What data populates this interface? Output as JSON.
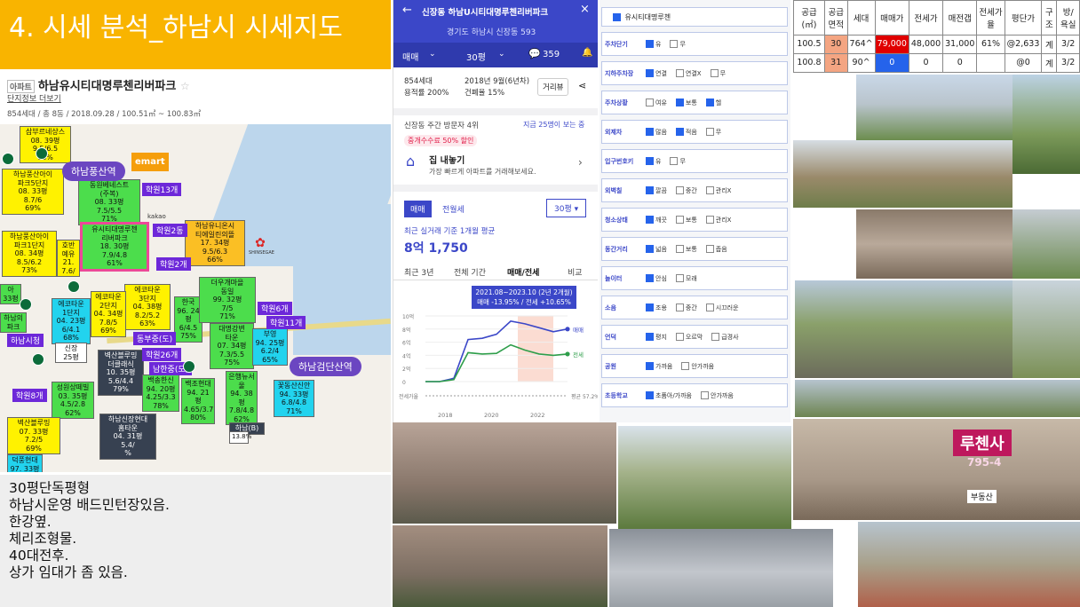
{
  "title": "4. 시세 분석_하남시 시세지도",
  "left": {
    "tag": "아파트",
    "complex_name": "하남유시티대명루첸리버파크",
    "info_link": "단지정보 더보기",
    "summary": "854세대 / 총 8동 / 2018.09.28 / 100.51㎡ ~ 100.83㎡"
  },
  "map": {
    "markers": [
      {
        "text": "삼부르네상스\n08. 39평\n9.5/6.5\n68%",
        "cls": "y"
      },
      {
        "text": "하남풍산아이\n파크5단지\n08. 33평\n8.7/6\n69%",
        "cls": "y"
      },
      {
        "text": "동원베네스트\n(주복)\n08. 33평\n7.5/5.5\n71%",
        "cls": "g"
      },
      {
        "text": "유시티대명루첸\n리버파크\n18. 30평\n7.9/4.8\n61%",
        "cls": "g"
      },
      {
        "text": "하남풍산아이\n파크1단지\n08. 34평\n8.5/6.2\n73%",
        "cls": "y"
      },
      {
        "text": "호반\n예유\n21.\n7.6/",
        "cls": "y"
      },
      {
        "text": "하남유니온시\n티에일린의뜰\n17. 34평\n9.5/6.3\n66%",
        "cls": "o"
      },
      {
        "text": "에코타운\n3단지\n04. 38평\n8.2/5.2\n63%",
        "cls": "y"
      },
      {
        "text": "에코타운\n2단지\n04. 34평\n7.8/5\n69%",
        "cls": "y"
      },
      {
        "text": "에코타운\n1단지\n04. 23평\n6/4.1\n68%",
        "cls": "c"
      },
      {
        "text": "한국\n96. 24평\n6/4.5\n75%",
        "cls": "g"
      },
      {
        "text": "더우개마을\n동일\n99. 32평\n7/5\n71%",
        "cls": "g"
      },
      {
        "text": "대명강변\n타운\n07. 34평\n7.3/5.5\n75%",
        "cls": "g"
      },
      {
        "text": "부영\n94. 25평\n6.2/4\n65%",
        "cls": "c"
      },
      {
        "text": "신장\n25평",
        "cls": "w"
      },
      {
        "text": "벽산블루밍\n더클래식\n10. 35평\n5.6/4.4\n79%",
        "cls": "b"
      },
      {
        "text": "백송한신\n94. 20평\n4.25/3.3\n78%",
        "cls": "g"
      },
      {
        "text": "백조현대\n94. 21평\n4.65/3.7\n80%",
        "cls": "g"
      },
      {
        "text": "은행뉴서\n울\n94. 38평\n7.8/4.8\n62%",
        "cls": "g"
      },
      {
        "text": "꽃동산신안\n94. 33평\n6.8/4.8\n71%",
        "cls": "c"
      },
      {
        "text": "성원상떼빌\n03. 35평\n4.5/2.8\n62%",
        "cls": "g"
      },
      {
        "text": "하남신장현대\n홈타운\n04. 31평\n5.4/\n%",
        "cls": "b"
      },
      {
        "text": "벽산블루밍\n07. 33평\n7.2/5\n69%",
        "cls": "y"
      },
      {
        "text": "덕풍현대\n97. 33평",
        "cls": "c"
      },
      {
        "text": "아\n33평\n",
        "cls": "g"
      },
      {
        "text": "하남의\n파크\n",
        "cls": "g"
      },
      {
        "text": "하남(B)",
        "cls": "b"
      },
      {
        "text": "13.8%",
        "cls": "w"
      }
    ],
    "labels": [
      "학원13개",
      "학원2동",
      "학원2개",
      "학원6개",
      "학원11개",
      "학원8개",
      "학원26개",
      "동부중(도)",
      "남한중(도)",
      "하남시청",
      "kakao"
    ],
    "stations": [
      "하남풍산역",
      "하남검단산역"
    ],
    "emart": "emart",
    "shinsegae": "SHINSEGAE"
  },
  "notes": [
    "30평단독평형",
    "하남시운영 배드민턴장있음.",
    "한강옆.",
    "체리조형물.",
    "40대전후.",
    "상가 임대가 좀 있음."
  ],
  "app": {
    "header_title": "신장동 하남U시티대명루첸리버파크",
    "address": "경기도 하남시 신장동 593",
    "tab_trade": "매매",
    "tab_size": "30평",
    "comment_count": "359",
    "households": "854세대",
    "ratio": "용적률 200%",
    "built": "2018년 9월(6년차)",
    "build_ratio": "건폐율 15%",
    "distance_button": "거리뷰",
    "visitors": "신장동 주간 방문자 4위",
    "visitors_right": "지금 25명이 보는 중",
    "promo_badge": "중개수수료 50% 할인",
    "promo_title": "집 내놓기",
    "promo_sub": "가장 빠르게 아파트를 거래해보세요.",
    "seg_trade": "매매",
    "seg_rent": "전월세",
    "size_select": "30평",
    "avg_label": "최근 실거래 기준 1개월 평균",
    "avg_price": "8억 1,750",
    "period_tabs": [
      "최근 3년",
      "전체 기간",
      "매매/전세",
      "비교"
    ],
    "chart_tooltip_title": "2021.08~2023.10 (2년 2개월)",
    "chart_tooltip_value": "매매 -13.95% / 전세 +10.65%"
  },
  "chart_data": {
    "type": "line",
    "x": [
      "2018",
      "2020",
      "2022"
    ],
    "ylim": [
      0,
      10
    ],
    "yticks": [
      "10억",
      "8억",
      "6억",
      "4억",
      "2억",
      "0"
    ],
    "series": [
      {
        "name": "매매",
        "values": [
          0,
          0,
          0.5,
          6.4,
          6.6,
          7.2,
          9.2,
          8.8,
          8.2,
          7.6,
          8.0
        ]
      },
      {
        "name": "전세",
        "values": [
          0,
          0,
          0.3,
          4.4,
          4.2,
          4.3,
          5.6,
          4.8,
          4.2,
          4.0,
          4.2
        ]
      }
    ],
    "bottom_label": "전세가율",
    "bottom_value": "평균 57.2%",
    "series_end_labels": [
      "매매",
      "전세"
    ]
  },
  "checklist": {
    "header": "유시티대명루첸",
    "rows": [
      {
        "label": "주차단기",
        "opts": [
          [
            "유",
            true
          ],
          [
            "무",
            false
          ]
        ]
      },
      {
        "label": "지하주차장",
        "opts": [
          [
            "연결",
            true
          ],
          [
            "연결X",
            false
          ],
          [
            "무",
            false
          ]
        ]
      },
      {
        "label": "주차상황",
        "opts": [
          [
            "여유",
            false
          ],
          [
            "보통",
            true
          ],
          [
            "헬",
            true
          ]
        ]
      },
      {
        "label": "외제차",
        "opts": [
          [
            "많음",
            true
          ],
          [
            "적음",
            true
          ],
          [
            "무",
            false
          ]
        ]
      },
      {
        "label": "입구번호키",
        "opts": [
          [
            "유",
            true
          ],
          [
            "무",
            false
          ]
        ]
      },
      {
        "label": "외벽칠",
        "opts": [
          [
            "깔끔",
            true
          ],
          [
            "중간",
            false
          ],
          [
            "관리X",
            false
          ]
        ]
      },
      {
        "label": "청소상태",
        "opts": [
          [
            "깨끗",
            true
          ],
          [
            "보통",
            false
          ],
          [
            "관리X",
            false
          ]
        ]
      },
      {
        "label": "동간거리",
        "opts": [
          [
            "넓음",
            true
          ],
          [
            "보통",
            false
          ],
          [
            "좁음",
            false
          ]
        ]
      },
      {
        "label": "놀이터",
        "opts": [
          [
            "안심",
            true
          ],
          [
            "모래",
            false
          ]
        ]
      },
      {
        "label": "소음",
        "opts": [
          [
            "조용",
            true
          ],
          [
            "중간",
            false
          ],
          [
            "시끄러운",
            false
          ]
        ]
      },
      {
        "label": "언덕",
        "opts": [
          [
            "평지",
            true
          ],
          [
            "오르막",
            false
          ],
          [
            "급경사",
            false
          ]
        ]
      },
      {
        "label": "공원",
        "opts": [
          [
            "가까움",
            true
          ],
          [
            "안가까움",
            false
          ]
        ]
      },
      {
        "label": "초등학교",
        "opts": [
          [
            "초품아/가까움",
            true
          ],
          [
            "안가까움",
            false
          ]
        ]
      }
    ]
  },
  "table": {
    "headers": [
      "공급(㎡)",
      "공급면적",
      "세대",
      "매매가",
      "전세가",
      "매전갭",
      "전세가율",
      "평단가",
      "구조",
      "방/욕실"
    ],
    "rows": [
      [
        "100.5",
        "30",
        "764^",
        "79,000",
        "48,000",
        "31,000",
        "61%",
        "@2,633",
        "계",
        "3/2"
      ],
      [
        "100.8",
        "31",
        "90^",
        "0",
        "0",
        "0",
        "",
        "@0",
        "계",
        "3/2"
      ]
    ]
  },
  "photos": {
    "sign_text": "루첸사",
    "sign_sub": "795-4",
    "sign_realty": "부동산"
  },
  "colors": {
    "banner": "#f9b400",
    "app_header": "#3b47c8",
    "sale_line": "#3b47c8",
    "rent_line": "#2e9e4a"
  }
}
